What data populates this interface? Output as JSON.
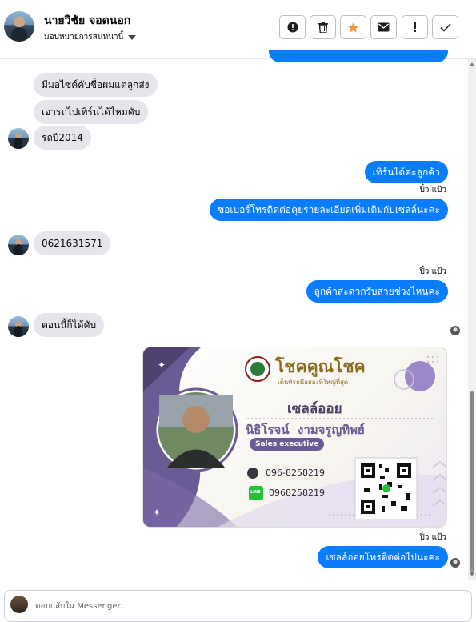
{
  "header": {
    "name": "นายวิชัย จอดนอก",
    "assign_label": "มอบหมายการสนทนานี้",
    "buttons": [
      "alert-circle",
      "trash",
      "star",
      "mail",
      "exclamation",
      "check"
    ],
    "star_color": "#f7923a"
  },
  "messages": [
    {
      "dir": "in",
      "text": "มีมอไซค์คับชื่อผมแต่ลูกส่ง"
    },
    {
      "dir": "in",
      "text": "เอารถไปเทิร์นได้ไหมคับ"
    },
    {
      "dir": "in",
      "text": "รถปี2014"
    },
    {
      "dir": "out",
      "text": "เทิร์นได้ค่ะลูกค้า"
    },
    {
      "dir": "seen",
      "text": "ปิ๋ว แป้ว"
    },
    {
      "dir": "out",
      "text": "ขอเบอร์โทรติดต่อคุยรายละเอียดเพิ่มเติมกับเซลล์นะคะ"
    },
    {
      "dir": "in",
      "text": "0621631571"
    },
    {
      "dir": "seen",
      "text": "ปิ๋ว แป้ว"
    },
    {
      "dir": "out",
      "text": "ลูกค้าสะดวกรับสายช่วงไหนคะ"
    },
    {
      "dir": "in",
      "text": "ตอนนี้ก็ได้คับ"
    },
    {
      "dir": "seen",
      "text": "ปิ๋ว แป้ว"
    },
    {
      "dir": "out",
      "text": "เซลล์ออยโทรติดต่อไปนะคะ"
    }
  ],
  "card": {
    "brand": "โชคคูณโชค",
    "tagline": "เต็นท์รถมือสองที่ใหญ่ที่สุด",
    "nickname": "เซลล์ออย",
    "fullname": "นิธิโรจน์  งามจรูญทิพย์",
    "role": "Sales executive",
    "phone": "096-8258219",
    "line": "0968258219",
    "line_badge": "LINE",
    "purple": "#6b5b95",
    "gold": "#8b6a1e"
  },
  "composer": {
    "placeholder": "ตอบกลับใน Messenger..."
  },
  "colors": {
    "outgoing": "#0a7cff",
    "incoming": "#e4e6eb"
  }
}
